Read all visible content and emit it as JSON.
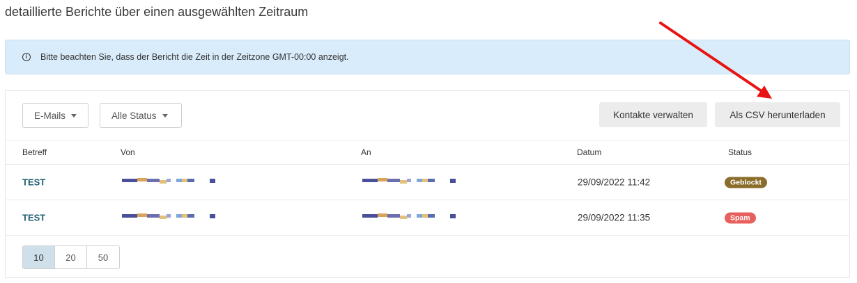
{
  "subtitle": "detaillierte Berichte über einen ausgewählten Zeitraum",
  "info": {
    "text": "Bitte beachten Sie, dass der Bericht die Zeit in der Zeitzone GMT-00:00 anzeigt.",
    "icon": "info-icon"
  },
  "filters": {
    "type_label": "E-Mails",
    "status_label": "Alle Status"
  },
  "actions": {
    "manage_contacts": "Kontakte verwalten",
    "download_csv": "Als CSV herunterladen"
  },
  "table": {
    "headers": {
      "subject": "Betreff",
      "from": "Von",
      "to": "An",
      "date": "Datum",
      "status": "Status"
    },
    "rows": [
      {
        "subject": "TEST",
        "date": "29/09/2022 11:42",
        "status": "Geblockt",
        "status_color": "#8a6d2b"
      },
      {
        "subject": "TEST",
        "date": "29/09/2022 11:35",
        "status": "Spam",
        "status_color": "#e8605e"
      }
    ]
  },
  "pagination": {
    "options": [
      "10",
      "20",
      "50"
    ],
    "selected": "10"
  },
  "colors": {
    "annotation_arrow": "#e81313",
    "info_background": "#d9ecfb",
    "subject_link": "#1f5f73"
  }
}
